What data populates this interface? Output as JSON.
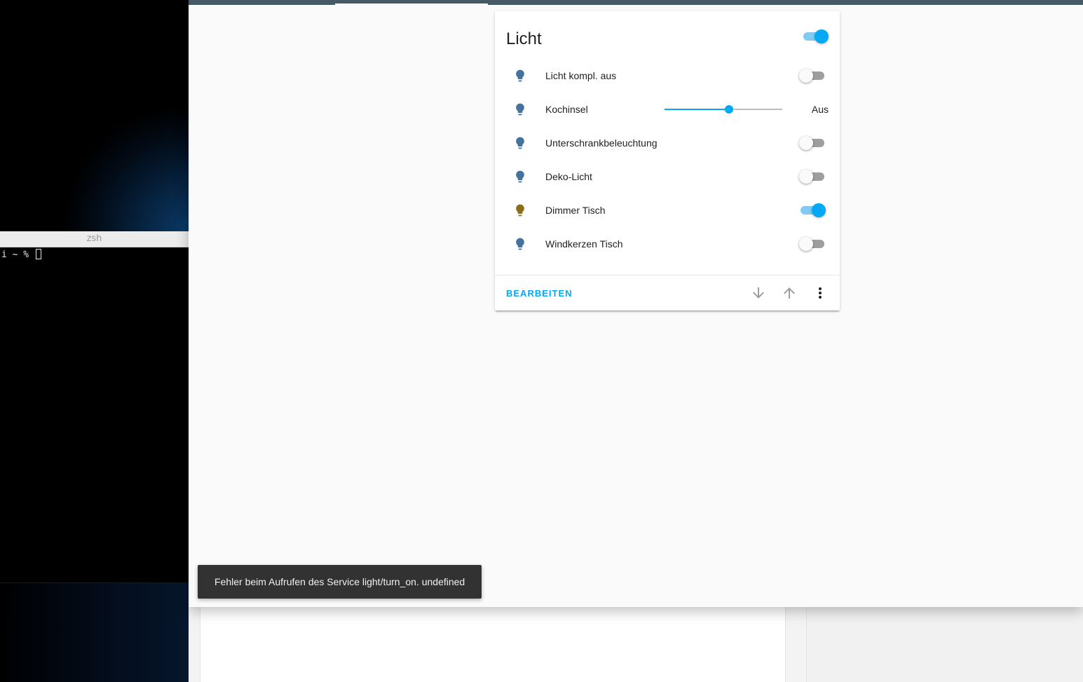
{
  "terminal": {
    "title": "zsh",
    "prompt": "i ~ % "
  },
  "card": {
    "title": "Licht",
    "master_on": true,
    "entities": [
      {
        "name": "Licht kompl. aus",
        "type": "toggle",
        "on": false,
        "icon": "lightbulb-icon",
        "icon_color": "#44739e"
      },
      {
        "name": "Kochinsel",
        "type": "slider",
        "value_percent": 55,
        "state": "Aus",
        "icon": "lightbulb-icon",
        "icon_color": "#44739e"
      },
      {
        "name": "Unterschrankbeleuchtung",
        "type": "toggle",
        "on": false,
        "icon": "lightbulb-icon",
        "icon_color": "#44739e"
      },
      {
        "name": "Deko-Licht",
        "type": "toggle",
        "on": false,
        "icon": "lightbulb-icon",
        "icon_color": "#44739e"
      },
      {
        "name": "Dimmer Tisch",
        "type": "toggle",
        "on": true,
        "icon": "lightbulb-icon",
        "icon_color": "#8a6c1a"
      },
      {
        "name": "Windkerzen Tisch",
        "type": "toggle",
        "on": false,
        "icon": "lightbulb-icon",
        "icon_color": "#44739e"
      }
    ],
    "actions": {
      "edit_label": "BEARBEITEN",
      "move_down_icon": "arrow-down-icon",
      "move_up_icon": "arrow-up-icon",
      "more_icon": "dots-vertical-icon"
    }
  },
  "toast": {
    "message": "Fehler beim Aufrufen des Service light/turn_on. undefined"
  },
  "colors": {
    "accent": "#03a9f4",
    "header": "#455a64",
    "icon_off": "#44739e",
    "icon_on": "#8a6c1a"
  }
}
